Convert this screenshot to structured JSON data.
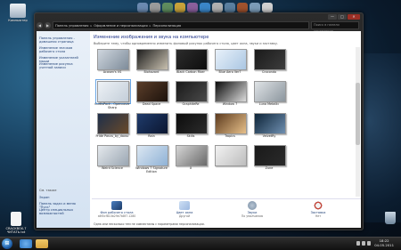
{
  "desktop": {
    "icons": [
      {
        "label": "Компьютер",
        "icon": "computer-icon",
        "color": "#dfe6ee"
      },
      {
        "label": "CRACKBOX-7 ЧИТАТЬ.txt",
        "icon": "text-file-icon",
        "color": "#f0f0f0"
      },
      {
        "label": "",
        "icon": "recycle-bin-icon",
        "color": "#9fb6cc"
      }
    ]
  },
  "window": {
    "breadcrumb": [
      "Панель управления",
      "Оформление и персонализация",
      "Персонализация"
    ],
    "search_placeholder": "Поиск в панели управления",
    "left_links": [
      "Панель управления - домашняя страница",
      "Изменение значков рабочего стола",
      "Изменение указателей мыши",
      "Изменение рисунка учетной записи"
    ],
    "see_also_title": "См. также",
    "see_also": [
      "Экран",
      "Панель задач и меню \"Пуск\"",
      "Центр специальных возможностей"
    ],
    "title": "Изменение изображения и звука на компьютере",
    "subtitle": "Выберите тему, чтобы одновременно изменить фоновый рисунок рабочего стола, цвет окна, звуки и заставку.",
    "themes": [
      {
        "name": "Acasen's VS",
        "colors": [
          "#cfd6de",
          "#7d8b99"
        ]
      },
      {
        "name": "Biohazard",
        "colors": [
          "#1d1d1d",
          "#c9c1b0"
        ]
      },
      {
        "name": "Black Carbon Fiber",
        "colors": [
          "#2c2c2c",
          "#0d0d0d"
        ]
      },
      {
        "name": "Blue Aero Ver7",
        "colors": [
          "#e8f1fa",
          "#aac6e2"
        ]
      },
      {
        "name": "Crocondo",
        "colors": [
          "#1a1a1a",
          "#3d3d3d"
        ]
      },
      {
        "name": "CurtisPack - Opencover Sharp",
        "colors": [
          "#eef2f6",
          "#c3ced9"
        ]
      },
      {
        "name": "Dead Space",
        "colors": [
          "#5b3e2a",
          "#1c120c"
        ]
      },
      {
        "name": "GraphiteRe",
        "colors": [
          "#191919",
          "#4a4a4a"
        ]
      },
      {
        "name": "Window 7",
        "colors": [
          "#0a0a0a",
          "#dcdcdc"
        ]
      },
      {
        "name": "Luna Metallic",
        "colors": [
          "#dfe3e6",
          "#8c969e"
        ]
      },
      {
        "name": "Pride Panzu_by_daxsc",
        "colors": [
          "#1e2f4a",
          "#6a4a2a"
        ]
      },
      {
        "name": "Rain",
        "colors": [
          "#1f3b6b",
          "#0b1630"
        ]
      },
      {
        "name": "Skills",
        "colors": [
          "#0c0c0c",
          "#2c2c2c"
        ]
      },
      {
        "name": "Tropics",
        "colors": [
          "#5c3a1e",
          "#e7c08a"
        ]
      },
      {
        "name": "VelvetRy",
        "colors": [
          "#0d2438",
          "#6f8fb0"
        ]
      },
      {
        "name": "Weird Science",
        "colors": [
          "#e5e9ed",
          "#9aa6b2"
        ]
      },
      {
        "name": "Windows 7 Signature Edition",
        "colors": [
          "#dce7f2",
          "#8fb2d6"
        ]
      },
      {
        "name": "X",
        "colors": [
          "#d6d6d6",
          "#6a6a6a"
        ]
      },
      {
        "name": "",
        "colors": [
          "#f2f2f2",
          "#bdbdbd"
        ]
      },
      {
        "name": "Zune",
        "colors": [
          "#1a1a1a",
          "#2a2a2a"
        ]
      }
    ],
    "bottom_buttons": [
      {
        "label": "Фон рабочего стола",
        "value": "a6f0cf810b29e7b8f7-1280",
        "color": "#4a7fc0"
      },
      {
        "label": "Цвет окна",
        "value": "Другой",
        "color": "#9bb8e0"
      },
      {
        "label": "Звуки",
        "value": "По умолчанию",
        "color": "#7a8ea4"
      },
      {
        "label": "Заставка",
        "value": "Нет",
        "color": "#c4473b"
      }
    ],
    "footnote": "Одна или несколько тем не совместимы с параметрами персонализации.",
    "controls": {
      "minimize": "—",
      "maximize": "□",
      "close": "✕",
      "back": "◀",
      "forward": "▶"
    }
  },
  "taskbar": {
    "start_label": "⊞",
    "time": "18:22",
    "date": "04.05.2011",
    "items": [
      {
        "icon": "internet-explorer-icon",
        "color": "#2f78c4"
      },
      {
        "icon": "folder-icon",
        "color": "#d9a640"
      }
    ]
  },
  "dock": {
    "items": [
      {
        "icon": "dock-item-icon",
        "color": "#6b89b0"
      },
      {
        "icon": "dock-item-icon",
        "color": "#9b9b9b"
      },
      {
        "icon": "dock-item-icon",
        "color": "#5e8c5e"
      },
      {
        "icon": "dock-item-icon",
        "color": "#c8a23a"
      },
      {
        "icon": "dock-item-icon",
        "color": "#8a5f9c"
      },
      {
        "icon": "dock-item-icon",
        "color": "#3a86c8"
      },
      {
        "icon": "dock-item-icon",
        "color": "#b0b0b0"
      },
      {
        "icon": "dock-item-icon",
        "color": "#5a7fa0"
      },
      {
        "icon": "dock-item-icon",
        "color": "#a0522d"
      },
      {
        "icon": "dock-item-icon",
        "color": "#7c9cb8"
      },
      {
        "icon": "dock-item-icon",
        "color": "#d0d0d0"
      }
    ]
  }
}
